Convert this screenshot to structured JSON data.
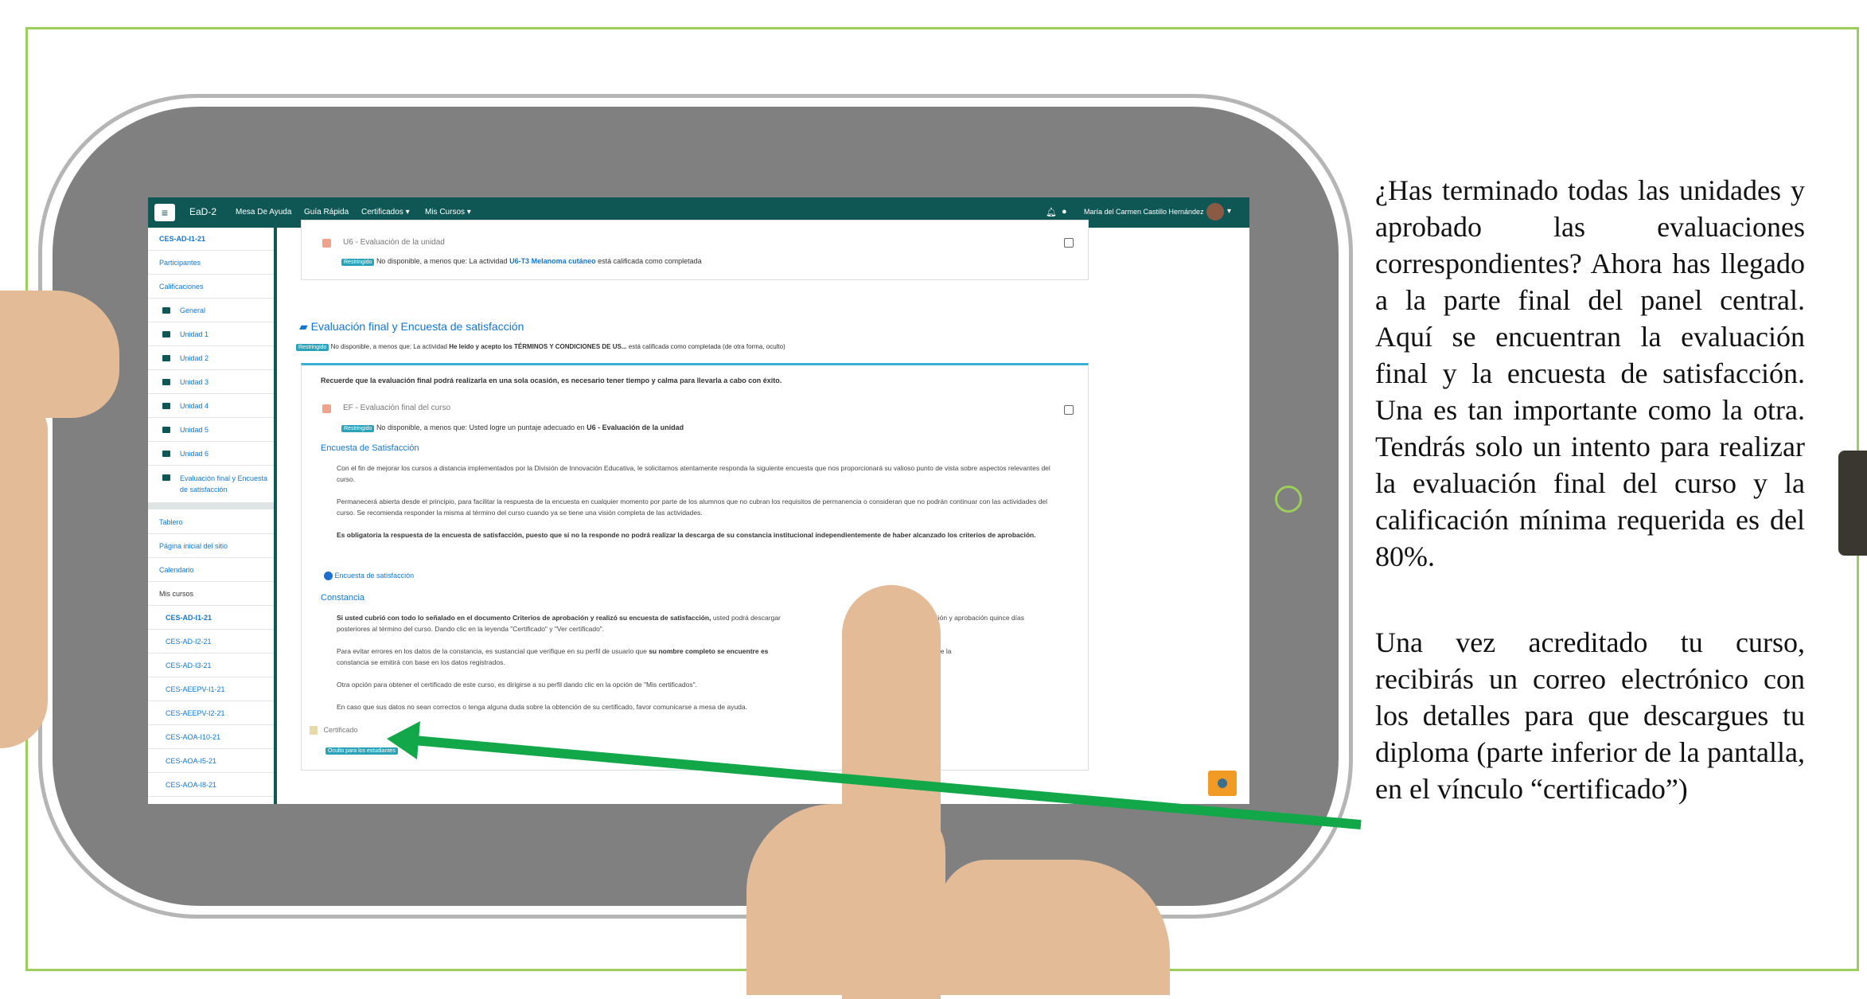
{
  "topnav": {
    "menu_icon": "hamburger-icon",
    "brand": "EaD-2",
    "items": [
      "Mesa De Ayuda",
      "Guía Rápida",
      "Certificados ▾",
      "Mis Cursos ▾"
    ],
    "user_name": "María del Carmen Castillo Hernández",
    "bell_icon": "bell-icon",
    "chat_icon": "chat-icon",
    "caret": "▾"
  },
  "sidebar": {
    "course": "CES-AD-I1-21",
    "items": [
      "Participantes",
      "Calificaciones"
    ],
    "sections": [
      "General",
      "Unidad 1",
      "Unidad 2",
      "Unidad 3",
      "Unidad 4",
      "Unidad 5",
      "Unidad 6"
    ],
    "final_section_line1": "Evaluación final y Encuesta",
    "final_section_line2": "de satisfacción",
    "lower_items": [
      "Tablero",
      "Página inicial del sitio",
      "Calendario",
      "Mis cursos"
    ],
    "courses": [
      "CES-AD-I1-21",
      "CES-AD-I2-21",
      "CES-AD-I3-21",
      "CES-AEEPV-I1-21",
      "CES-AEEPV-I2-21",
      "CES-AOA-I10-21",
      "CES-AOA-I5-21",
      "CES-AOA-I8-21"
    ]
  },
  "unit6": {
    "activity": "U6 - Evaluación de la unidad",
    "restricted_tag": "Restringido",
    "restriction_prefix": "No disponible, a menos que: La actividad",
    "restriction_link": "U6-T3 Melanoma cutáneo",
    "restriction_suffix": "está calificada como completada"
  },
  "final_section": {
    "title": "Evaluación final y Encuesta de satisfacción",
    "folder_icon": "folder-open-icon",
    "restricted_tag": "Restringido",
    "restriction_prefix": "No disponible, a menos que: La actividad",
    "restriction_bold": "He leído y acepto los TÉRMINOS Y CONDICIONES DE US...",
    "restriction_suffix": "está calificada como completada (de otra forma, oculto)",
    "notice": "Recuerde que la evaluación final podrá realizarla en una sola ocasión, es necesario tener tiempo y calma para llevarla a cabo con éxito.",
    "ef_activity": "EF - Evaluación final del curso",
    "ef_restriction_prefix": "No disponible, a menos que: Usted logre un puntaje adecuado en",
    "ef_restriction_bold": "U6 - Evaluación de la unidad",
    "survey_heading": "Encuesta de Satisfacción",
    "survey_p1": "Con el fin de mejorar los cursos a distancia implementados por la División de Innovación Educativa, le solicitamos atentamente responda la siguiente encuesta que nos proporcionará su valioso punto de vista sobre aspectos relevantes del curso.",
    "survey_p2": "Permanecerá abierta desde el principio, para facilitar la respuesta de la encuesta en cualquier momento por parte de los alumnos que no cubran los requisitos de permanencia o consideran que no podrán continuar con las actividades del curso. Se recomienda responder la misma al término del curso cuando ya se tiene una visión completa de las actividades.",
    "survey_p3": "Es obligatoria la respuesta de la encuesta de satisfacción, puesto que si no la responde no podrá realizar la descarga de su constancia institucional independientemente de haber alcanzado los criterios de aprobación.",
    "survey_link": "Encuesta de satisfacción",
    "constancia_heading": "Constancia",
    "const_p1_bold": "Si usted cubrió con todo lo señalado en el documento Criterios de aprobación y realizó su encuesta de satisfacción,",
    "const_p1_rest": "usted podrá descargar",
    "const_p1_tail": "rminación y aprobación quince días",
    "const_p1_line2": "posteriores al término del curso. Dando clic en la leyenda \"Certificado\" y \"Ver certificado\".",
    "const_p2_a": "Para evitar errores en los datos de la constancia, es sustancial que verifique en su perfil de usuario que",
    "const_p2_bold": "su nombre completo se encuentre es",
    "const_p2_tail": "(incluyendo acentos), ya que la",
    "const_p2_line2": "constancia se emitirá con base en los datos registrados.",
    "const_p3": "Otra opción para obtener el certificado de este curso, es dirigirse a su perfil dando clic en la opción de \"Mis certificados\".",
    "const_p4": "En caso que sus datos no sean correctos o tenga alguna duda sobre la obtención de su certificado, favor comunicarse a mesa de ayuda.",
    "certificate": "Certificado",
    "hidden_tag": "Oculto para los estudiantes"
  },
  "explanation": {
    "p1": "¿Has terminado todas las unidades y aprobado las evaluaciones correspondientes? Ahora has llegado a la parte final del panel central. Aquí se encuentran la evaluación final y la encuesta de satisfacción. Una es tan importante como la otra. Tendrás solo un intento para realizar la evaluación final del curso y la calificación mínima requerida es del 80%.",
    "p2": "Una vez acreditado tu curso, recibirás un correo electrónico con los detalles para que descargues tu diploma (parte inferior de la pantalla, en el vínculo “certificado”)"
  },
  "colors": {
    "frame_border": "#9ccf5a",
    "tablet_body": "#808080",
    "nav_bg": "#0f5755",
    "link": "#1177d1",
    "arrow": "#12a84a",
    "skin": "#e3bb97",
    "fab": "#f29b24"
  }
}
